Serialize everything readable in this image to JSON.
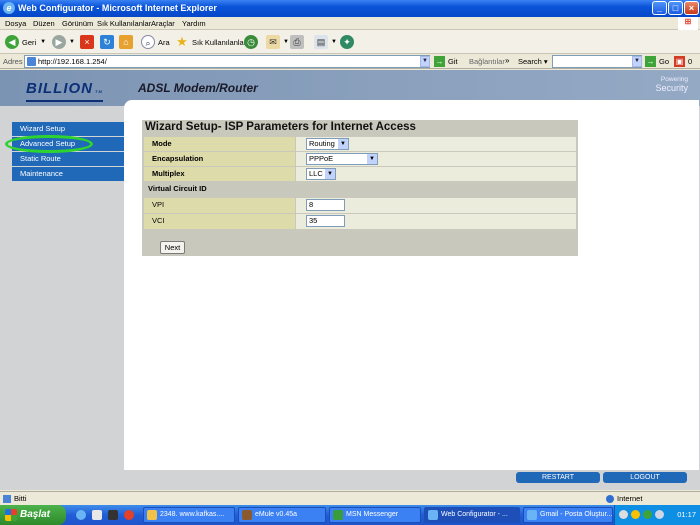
{
  "window": {
    "title": "Web Configurator - Microsoft Internet Explorer"
  },
  "menu": {
    "items": [
      "Dosya",
      "Düzen",
      "Görünüm",
      "Sık Kullanılanlar",
      "Araçlar",
      "Yardım"
    ]
  },
  "toolbar": {
    "back": "Geri",
    "search": "Ara",
    "favorites": "Sık Kullanılanlar"
  },
  "address": {
    "label": "Adres",
    "url": "http://192.168.1.254/",
    "go": "Git",
    "links": "Bağlantılar",
    "search_label": "Search",
    "go2": "Go",
    "count": "0"
  },
  "page": {
    "brand": "BILLION",
    "brand_tm": "TM",
    "app_title": "ADSL Modem/Router",
    "powering_line1": "Powering",
    "powering_line2": "Security",
    "nav": [
      "Wizard Setup",
      "Advanced Setup",
      "Static Route",
      "Maintenance"
    ],
    "form": {
      "title": "Wizard Setup- ISP Parameters for Internet Access",
      "mode_label": "Mode",
      "mode_value": "Routing",
      "encap_label": "Encapsulation",
      "encap_value": "PPPoE",
      "mux_label": "Multiplex",
      "mux_value": "LLC",
      "vc_section": "Virtual Circuit ID",
      "vpi_label": "VPI",
      "vpi_value": "8",
      "vci_label": "VCI",
      "vci_value": "35",
      "next": "Next"
    },
    "restart": "RESTART",
    "logout": "LOGOUT"
  },
  "status": {
    "left": "Bitti",
    "zone": "Internet"
  },
  "taskbar": {
    "start": "Başlat",
    "tasks": [
      "2348. www.kafkas....",
      "eMule v0.45a",
      "MSN Messenger",
      "Web Configurator - ...",
      "Gmail - Posta Oluştur..."
    ],
    "clock": "01:17"
  }
}
